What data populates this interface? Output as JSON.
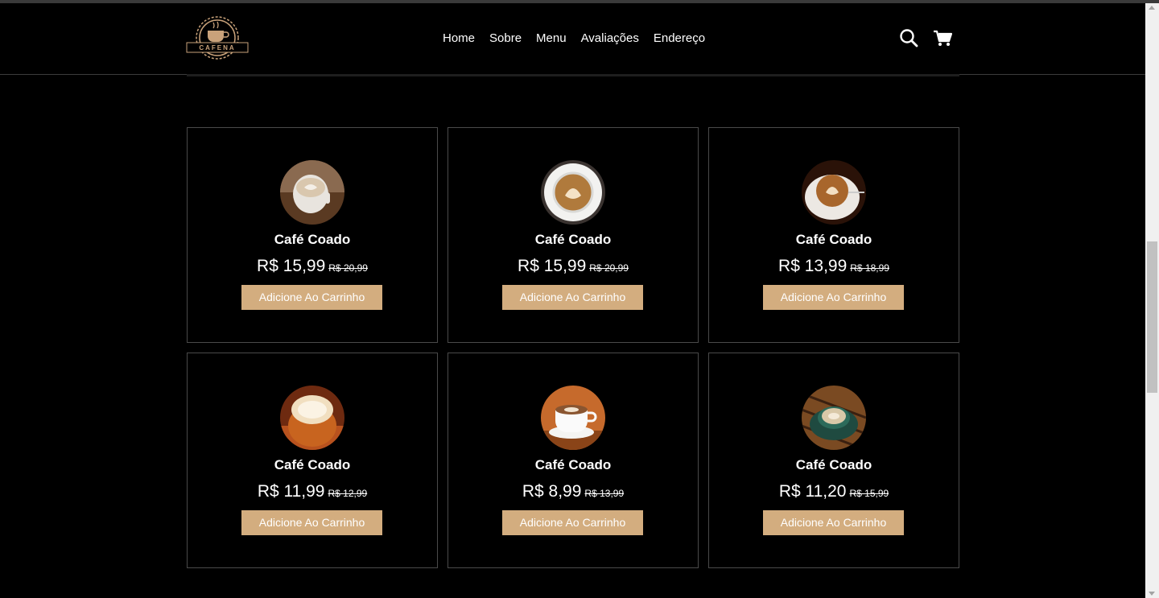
{
  "brand": {
    "name": "CAFENA"
  },
  "nav": [
    {
      "label": "Home"
    },
    {
      "label": "Sobre"
    },
    {
      "label": "Menu"
    },
    {
      "label": "Avaliações"
    },
    {
      "label": "Endereço"
    }
  ],
  "colors": {
    "accent": "#d3ad7f",
    "background": "#000000",
    "border": "#4a4a4a"
  },
  "products": [
    {
      "name": "Café Coado",
      "price": "R$ 15,99",
      "old_price": "R$ 20,99",
      "button": "Adicione Ao Carrinho"
    },
    {
      "name": "Café Coado",
      "price": "R$ 15,99",
      "old_price": "R$ 20,99",
      "button": "Adicione Ao Carrinho"
    },
    {
      "name": "Café Coado",
      "price": "R$ 13,99",
      "old_price": "R$ 18,99",
      "button": "Adicione Ao Carrinho"
    },
    {
      "name": "Café Coado",
      "price": "R$ 11,99",
      "old_price": "R$ 12,99",
      "button": "Adicione Ao Carrinho"
    },
    {
      "name": "Café Coado",
      "price": "R$ 8,99",
      "old_price": "R$ 13,99",
      "button": "Adicione Ao Carrinho"
    },
    {
      "name": "Café Coado",
      "price": "R$ 11,20",
      "old_price": "R$ 15,99",
      "button": "Adicione Ao Carrinho"
    }
  ]
}
